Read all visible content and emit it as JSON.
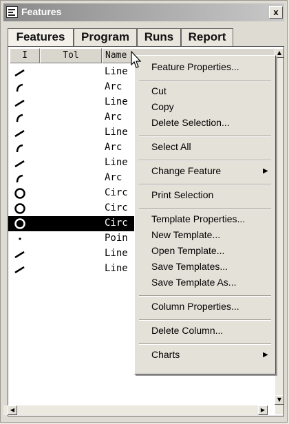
{
  "window": {
    "title": "Features",
    "close_label": "x"
  },
  "tabs": [
    {
      "label": "Features",
      "active": true
    },
    {
      "label": "Program",
      "active": false
    },
    {
      "label": "Runs",
      "active": false
    },
    {
      "label": "Report",
      "active": false
    }
  ],
  "columns": {
    "type": "I",
    "tol": "Tol",
    "name": "Name"
  },
  "rows": [
    {
      "icon": "line",
      "name": "Line"
    },
    {
      "icon": "arc",
      "name": "Arc"
    },
    {
      "icon": "line",
      "name": "Line"
    },
    {
      "icon": "arc",
      "name": "Arc"
    },
    {
      "icon": "line",
      "name": "Line"
    },
    {
      "icon": "arc",
      "name": "Arc"
    },
    {
      "icon": "line",
      "name": "Line"
    },
    {
      "icon": "arc",
      "name": "Arc"
    },
    {
      "icon": "circle",
      "name": "Circ"
    },
    {
      "icon": "circle",
      "name": "Circ"
    },
    {
      "icon": "circle",
      "name": "Circ",
      "selected": true
    },
    {
      "icon": "point",
      "name": "Poin"
    },
    {
      "icon": "line",
      "name": "Line"
    },
    {
      "icon": "line",
      "name": "Line"
    }
  ],
  "context_menu": {
    "groups": [
      [
        "Feature Properties..."
      ],
      [
        "Cut",
        "Copy",
        "Delete Selection..."
      ],
      [
        "Select All"
      ],
      [
        "Change Feature"
      ],
      [
        "Print Selection"
      ],
      [
        "Template Properties...",
        "New Template...",
        "Open Template...",
        "Save Templates...",
        "Save Template As..."
      ],
      [
        "Column Properties..."
      ],
      [
        "Delete Column..."
      ],
      [
        "Charts"
      ]
    ],
    "submenu_items": [
      "Change Feature",
      "Charts"
    ]
  },
  "colors": {
    "selection": "#000000",
    "titlebar": "#8a8a8a",
    "menu_bg": "#e4e1d8"
  }
}
